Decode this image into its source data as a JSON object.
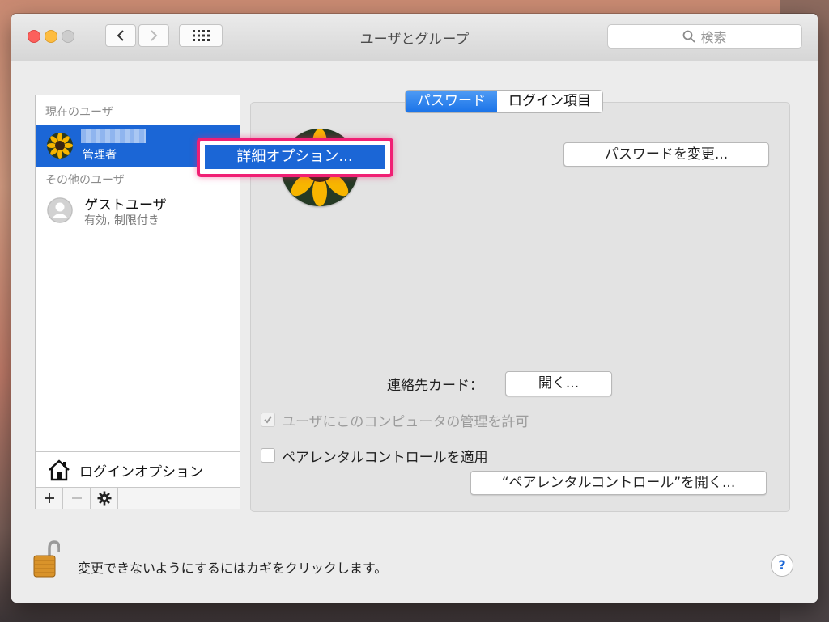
{
  "window": {
    "title": "ユーザとグループ"
  },
  "toolbar": {
    "search_placeholder": "検索"
  },
  "sidebar": {
    "current_header": "現在のユーザ",
    "current_user": {
      "name": "",
      "role": "管理者"
    },
    "other_header": "その他のユーザ",
    "guest": {
      "name": "ゲストユーザ",
      "status": "有効, 制限付き"
    },
    "login_options": "ログインオプション"
  },
  "tabs": [
    {
      "label": "パスワード"
    },
    {
      "label": "ログイン項目"
    }
  ],
  "context_menu": {
    "item": "詳細オプション..."
  },
  "main": {
    "change_password": "パスワードを変更...",
    "contact_label": "連絡先カード：",
    "open_button": "開く...",
    "allow_admin": "ユーザにこのコンピュータの管理を許可",
    "parental_checkbox": "ペアレンタルコントロールを適用",
    "open_parental": "“ペアレンタルコントロール”を開く..."
  },
  "bottom": {
    "lock_text": "変更できないようにするにはカギをクリックします。",
    "help": "?"
  },
  "colors": {
    "accent": "#1b66d6",
    "highlight": "#f01f74"
  }
}
